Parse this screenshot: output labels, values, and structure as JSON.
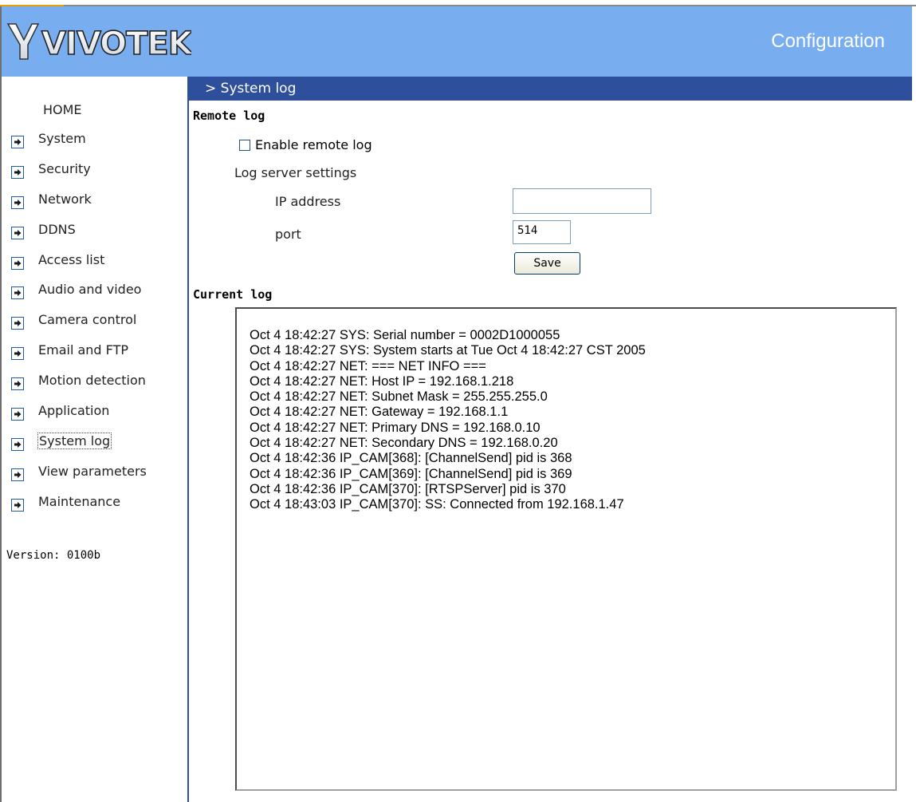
{
  "header": {
    "logo_text": "VIVOTEK",
    "title": "Configuration"
  },
  "sidebar": {
    "home": "HOME",
    "items": [
      {
        "label": "System"
      },
      {
        "label": "Security"
      },
      {
        "label": "Network"
      },
      {
        "label": "DDNS"
      },
      {
        "label": "Access list"
      },
      {
        "label": "Audio and video"
      },
      {
        "label": "Camera control"
      },
      {
        "label": "Email and FTP"
      },
      {
        "label": "Motion detection"
      },
      {
        "label": "Application"
      },
      {
        "label": "System log",
        "active": true
      },
      {
        "label": "View parameters"
      },
      {
        "label": "Maintenance"
      }
    ],
    "version": "Version: 0100b"
  },
  "page": {
    "title": "> System log",
    "remote_log": {
      "heading": "Remote log",
      "enable_label": "Enable remote log",
      "enabled": false,
      "server_settings_label": "Log server settings",
      "ip_label": "IP address",
      "ip_value": "",
      "port_label": "port",
      "port_value": "514",
      "save_label": "Save"
    },
    "current_log": {
      "heading": "Current log",
      "lines": [
        "Oct 4 18:42:27 SYS: Serial number = 0002D1000055",
        "Oct 4 18:42:27 SYS: System starts at Tue Oct 4 18:42:27 CST 2005",
        "Oct 4 18:42:27 NET: === NET INFO ===",
        "Oct 4 18:42:27 NET: Host IP = 192.168.1.218",
        "Oct 4 18:42:27 NET: Subnet Mask = 255.255.255.0",
        "Oct 4 18:42:27 NET: Gateway = 192.168.1.1",
        "Oct 4 18:42:27 NET: Primary DNS = 192.168.0.10",
        "Oct 4 18:42:27 NET: Secondary DNS = 192.168.0.20",
        "Oct 4 18:42:36 IP_CAM[368]: [ChannelSend] pid is 368",
        "Oct 4 18:42:36 IP_CAM[369]: [ChannelSend] pid is 369",
        "Oct 4 18:42:36 IP_CAM[370]: [RTSPServer] pid is 370",
        "Oct 4 18:43:03 IP_CAM[370]: SS: Connected from 192.168.1.47"
      ]
    }
  },
  "colors": {
    "header_bg": "#78adf0",
    "titlebar_bg": "#2d4f9c",
    "menu_arrow_bg": "#1e5aa8"
  },
  "icons": {
    "menu_arrow": "arrow-right-icon",
    "logo": "vivotek-logo"
  }
}
